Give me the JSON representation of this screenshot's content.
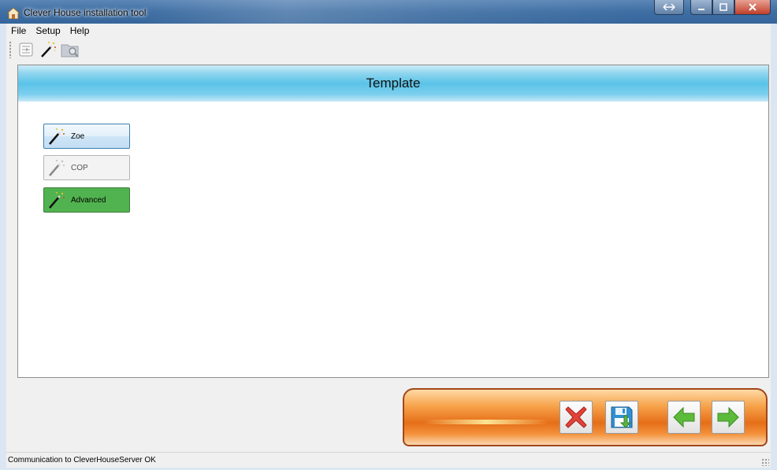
{
  "window": {
    "title": "Clever House installation tool",
    "icon": "house-icon",
    "caption_buttons": [
      "restore-icon",
      "minimize-icon",
      "maximize-icon",
      "close-icon"
    ]
  },
  "menu": {
    "items": [
      {
        "label": "File"
      },
      {
        "label": "Setup"
      },
      {
        "label": "Help"
      }
    ]
  },
  "toolbar": {
    "buttons": [
      {
        "icon": "settings-list-icon"
      },
      {
        "icon": "magic-wand-icon"
      },
      {
        "icon": "folder-search-icon"
      }
    ]
  },
  "panel": {
    "title": "Template",
    "templates": [
      {
        "label": "Zoe",
        "state": "focused"
      },
      {
        "label": "COP",
        "state": "disabled"
      },
      {
        "label": "Advanced",
        "state": "selected"
      }
    ]
  },
  "navbar": {
    "buttons": [
      {
        "name": "cancel",
        "icon": "red-x-icon"
      },
      {
        "name": "save",
        "icon": "floppy-save-icon"
      },
      {
        "name": "back",
        "icon": "green-left-arrow-icon"
      },
      {
        "name": "next",
        "icon": "green-right-arrow-icon"
      }
    ]
  },
  "status": {
    "text": "Communication to CleverHouseServer OK"
  },
  "colors": {
    "header_blue": "#5ac3e8",
    "advanced_green": "#51b34f",
    "navbar_orange": "#e66e18"
  }
}
